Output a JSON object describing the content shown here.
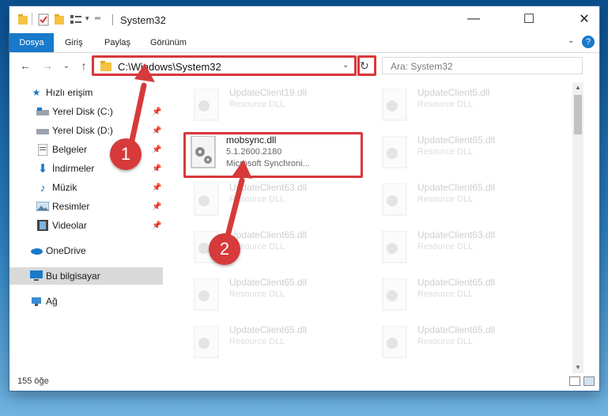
{
  "window": {
    "title": "System32"
  },
  "ribbon": {
    "tabs": [
      "Dosya",
      "Giriş",
      "Paylaş",
      "Görünüm"
    ]
  },
  "address": {
    "path": "C:\\Windows\\System32"
  },
  "search": {
    "placeholder": "Ara: System32"
  },
  "sidebar": {
    "items": [
      {
        "label": "Hızlı erişim",
        "icon": "star-icon"
      },
      {
        "label": "Yerel Disk (C:)",
        "icon": "drive-icon",
        "pinned": true
      },
      {
        "label": "Yerel Disk (D:)",
        "icon": "drive-icon",
        "pinned": true
      },
      {
        "label": "Belgeler",
        "icon": "documents-icon",
        "pinned": true
      },
      {
        "label": "İndirmeler",
        "icon": "downloads-icon",
        "pinned": true
      },
      {
        "label": "Müzik",
        "icon": "music-icon",
        "pinned": true
      },
      {
        "label": "Resimler",
        "icon": "pictures-icon",
        "pinned": true
      },
      {
        "label": "Videolar",
        "icon": "videos-icon",
        "pinned": true
      },
      {
        "label": "OneDrive",
        "icon": "cloud-icon"
      },
      {
        "label": "Bu bilgisayar",
        "icon": "computer-icon",
        "selected": true
      },
      {
        "label": "Ağ",
        "icon": "network-icon"
      }
    ]
  },
  "files": {
    "highlighted": {
      "name": "mobsync.dll",
      "version": "5.1.2600.2180",
      "description": "Microsoft Synchroni..."
    },
    "tiles": [
      {
        "name": "UpdateClient19.dll",
        "type": "Resource DLL"
      },
      {
        "name": "UpdateClient5.dll",
        "type": "Resource DLL"
      },
      {
        "name": "UpdateClient65.dll",
        "type": "Resource DLL"
      },
      {
        "name": "UpdateClient63.dll",
        "type": "Resource DLL"
      },
      {
        "name": "UpdateClient65.dll",
        "type": "Resource DLL"
      },
      {
        "name": "UpdateClient65.dll",
        "type": "Resource DLL"
      },
      {
        "name": "UpdateClient63.dll",
        "type": "Resource DLL"
      },
      {
        "name": "UpdateClient65.dll",
        "type": "Resource DLL"
      },
      {
        "name": "UpdateClient65.dll",
        "type": "Resource DLL"
      },
      {
        "name": "UpdateClient65.dll",
        "type": "Resource DLL"
      },
      {
        "name": "UpdateClient65.dll",
        "type": "Resource DLL"
      },
      {
        "name": "UpdateClient65.dll",
        "type": "Resource DLL"
      }
    ]
  },
  "status": {
    "count": "155 öğe"
  },
  "annotations": {
    "step1": "1",
    "step2": "2"
  },
  "colors": {
    "accent": "#1979ca",
    "highlight": "#d9383a"
  }
}
